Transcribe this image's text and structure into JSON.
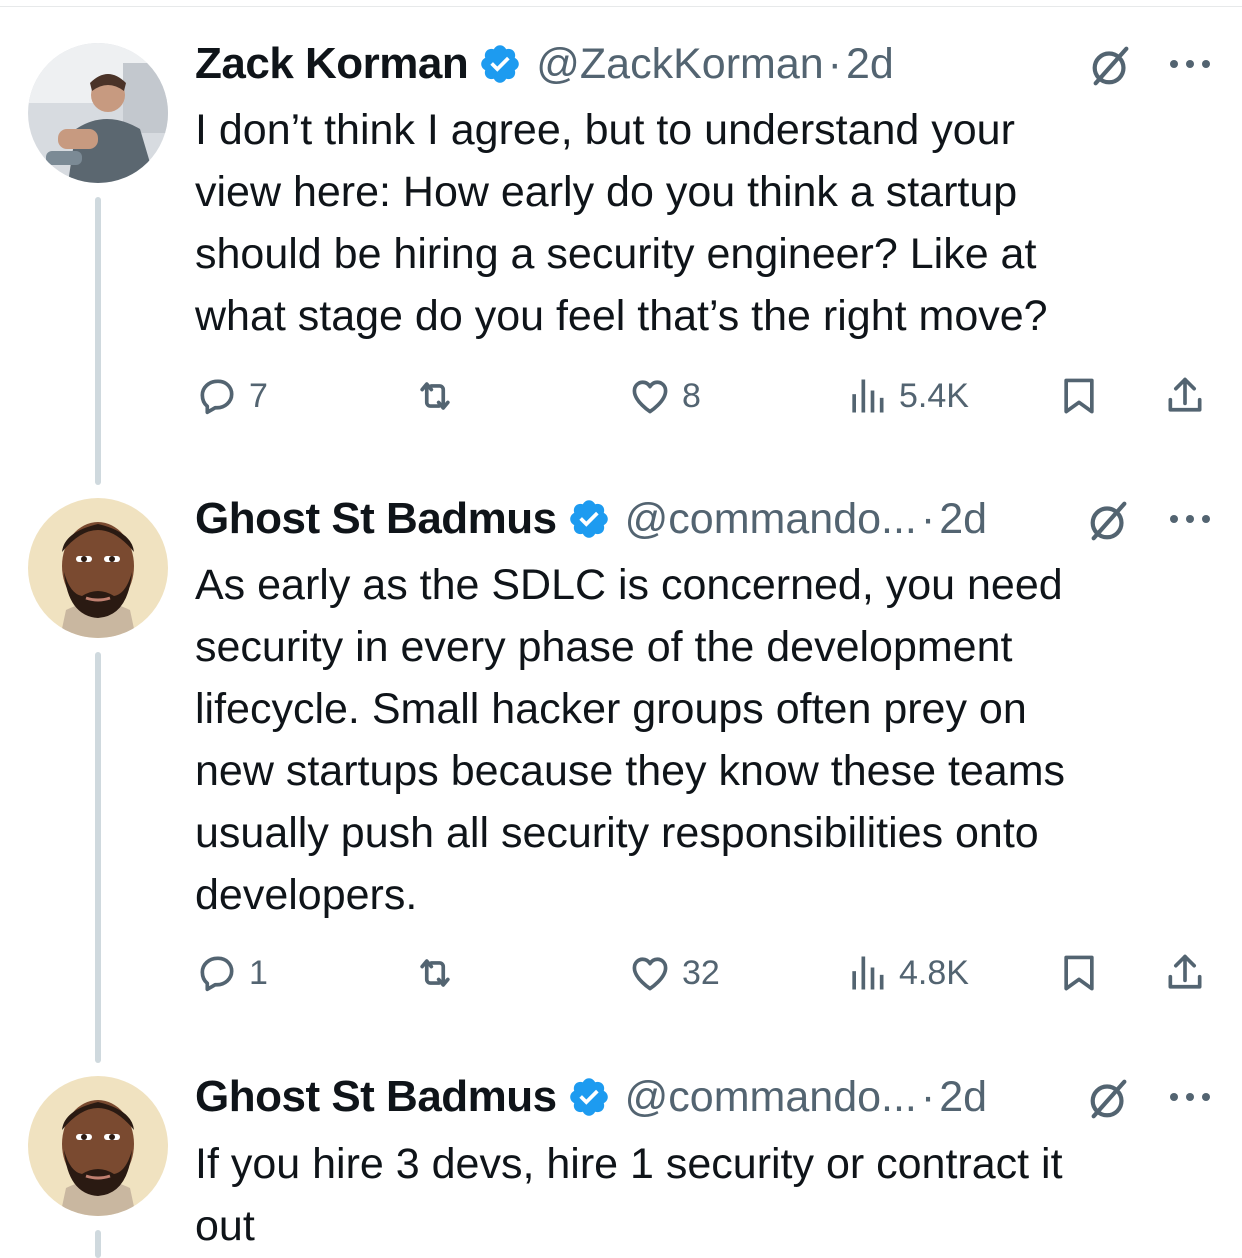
{
  "tweets": [
    {
      "name": "Zack Korman",
      "handle": "@ZackKorman",
      "dot": "·",
      "time": "2d",
      "text": "I don’t think I agree, but to understand your\nview here: How early do you think a startup\nshould be hiring a security engineer? Like at\nwhat stage do you feel that’s the right move?",
      "replies": "7",
      "likes": "8",
      "views": "5.4K"
    },
    {
      "name": "Ghost St Badmus",
      "handle": "@commando...",
      "dot": "·",
      "time": "2d",
      "text": "As early as the SDLC is concerned, you need\nsecurity in every phase of the development\nlifecycle. Small hacker groups often prey on\nnew startups because they know these teams\nusually push all security responsibilities onto\ndevelopers.",
      "replies": "1",
      "likes": "32",
      "views": "4.8K"
    },
    {
      "name": "Ghost St Badmus",
      "handle": "@commando...",
      "dot": "·",
      "time": "2d",
      "text": "If you hire 3 devs, hire 1 security or contract it\nout"
    }
  ],
  "colors": {
    "text": "#0f1419",
    "secondary": "#536471",
    "verified": "#1d9bf0",
    "thread_line": "#cfd9de"
  },
  "icons": {
    "verified": "verified-badge-icon",
    "grok": "grok-icon",
    "more": "more-icon",
    "reply": "reply-icon",
    "retweet": "retweet-icon",
    "like": "heart-icon",
    "views": "views-icon",
    "bookmark": "bookmark-icon",
    "share": "share-icon"
  }
}
